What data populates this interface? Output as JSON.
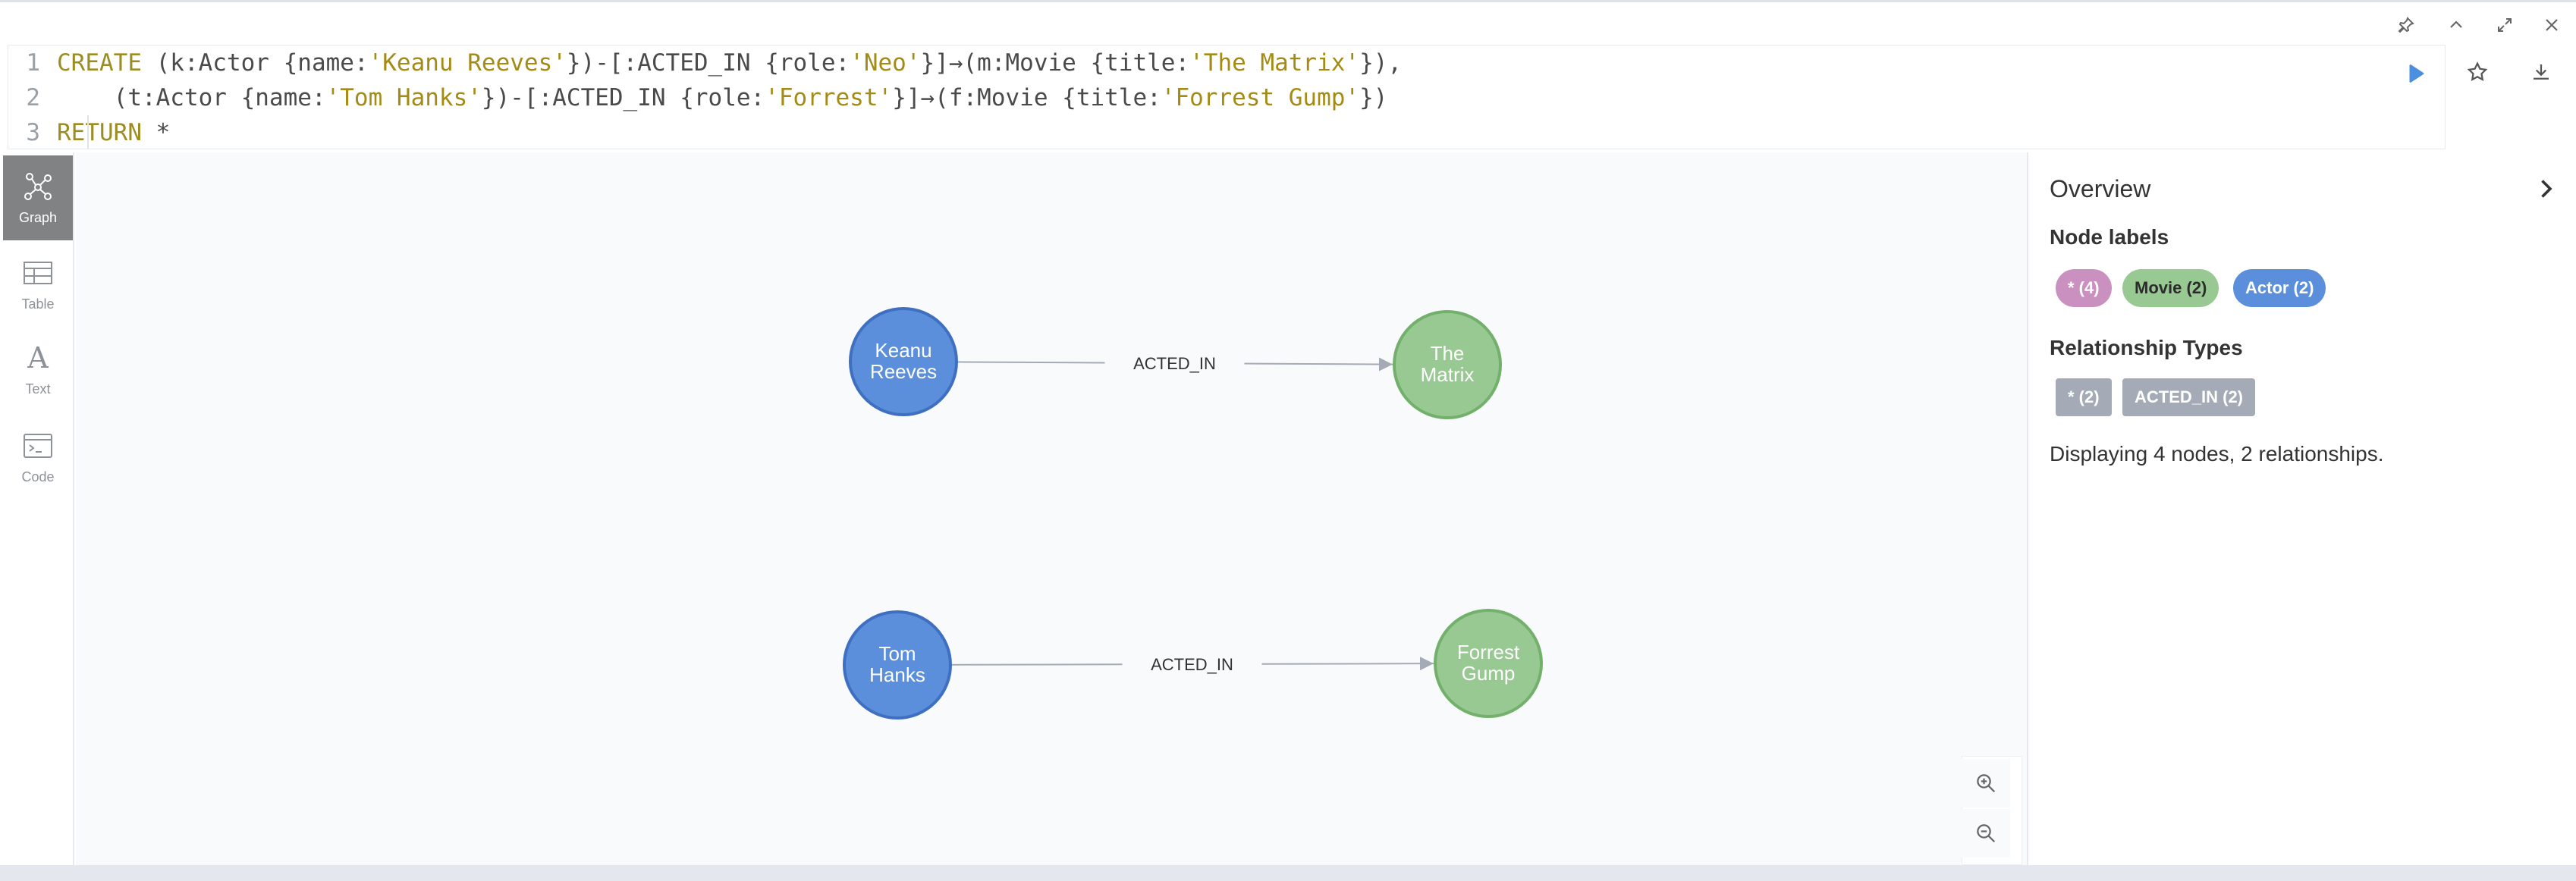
{
  "window_controls": [
    "pin-icon",
    "collapse-up-icon",
    "fullscreen-icon",
    "close-icon"
  ],
  "editor": {
    "line_numbers": [
      "1",
      "2",
      "3"
    ],
    "line1": {
      "kw": "CREATE",
      "p1": " (k:Actor {name:",
      "s1": "'Keanu Reeves'",
      "p2": "})-[:ACTED_IN {role:",
      "s2": "'Neo'",
      "p3": "}]→(m:Movie {title:",
      "s3": "'The Matrix'",
      "p4": "}),"
    },
    "line2": {
      "p0": "    (t:Actor {name:",
      "s1": "'Tom Hanks'",
      "p2": "})-[:ACTED_IN {role:",
      "s2": "'Forrest'",
      "p3": "}]→(f:Movie {title:",
      "s3": "'Forrest Gump'",
      "p4": "})"
    },
    "line3": {
      "kw": "RETURN",
      "p1": " *"
    },
    "run_icon": "play-icon",
    "favorite_icon": "star-icon",
    "download_icon": "download-icon"
  },
  "views": [
    {
      "label": "Graph",
      "icon": "graph-icon",
      "active": true
    },
    {
      "label": "Table",
      "icon": "table-icon",
      "active": false
    },
    {
      "label": "Text",
      "icon": "text-icon",
      "active": false
    },
    {
      "label": "Code",
      "icon": "code-icon",
      "active": false
    }
  ],
  "graph": {
    "nodes": [
      {
        "id": "k",
        "lines": [
          "Keanu",
          "Reeves"
        ],
        "label": "Actor",
        "color": "#5b8fdb",
        "stroke": "#3e6fc1"
      },
      {
        "id": "m",
        "lines": [
          "The",
          "Matrix"
        ],
        "label": "Movie",
        "color": "#98c993",
        "stroke": "#72b06b"
      },
      {
        "id": "t",
        "lines": [
          "Tom",
          "Hanks"
        ],
        "label": "Actor",
        "color": "#5b8fdb",
        "stroke": "#3e6fc1"
      },
      {
        "id": "f",
        "lines": [
          "Forrest",
          "Gump"
        ],
        "label": "Movie",
        "color": "#98c993",
        "stroke": "#72b06b"
      }
    ],
    "relationships": [
      {
        "from": "k",
        "to": "m",
        "type": "ACTED_IN"
      },
      {
        "from": "t",
        "to": "f",
        "type": "ACTED_IN"
      }
    ],
    "zoom_in_icon": "zoom-in-icon",
    "zoom_out_icon": "zoom-out-icon"
  },
  "overview": {
    "title": "Overview",
    "node_labels_heading": "Node labels",
    "node_labels": [
      {
        "text": "* (4)",
        "color": "#c990c0"
      },
      {
        "text": "Movie (2)",
        "color": "#98c993"
      },
      {
        "text": "Actor (2)",
        "color": "#5b8fdb"
      }
    ],
    "rel_types_heading": "Relationship Types",
    "rel_types": [
      {
        "text": "* (2)",
        "color": "#a5abb6"
      },
      {
        "text": "ACTED_IN (2)",
        "color": "#a5abb6"
      }
    ],
    "summary": "Displaying 4 nodes, 2 relationships."
  }
}
